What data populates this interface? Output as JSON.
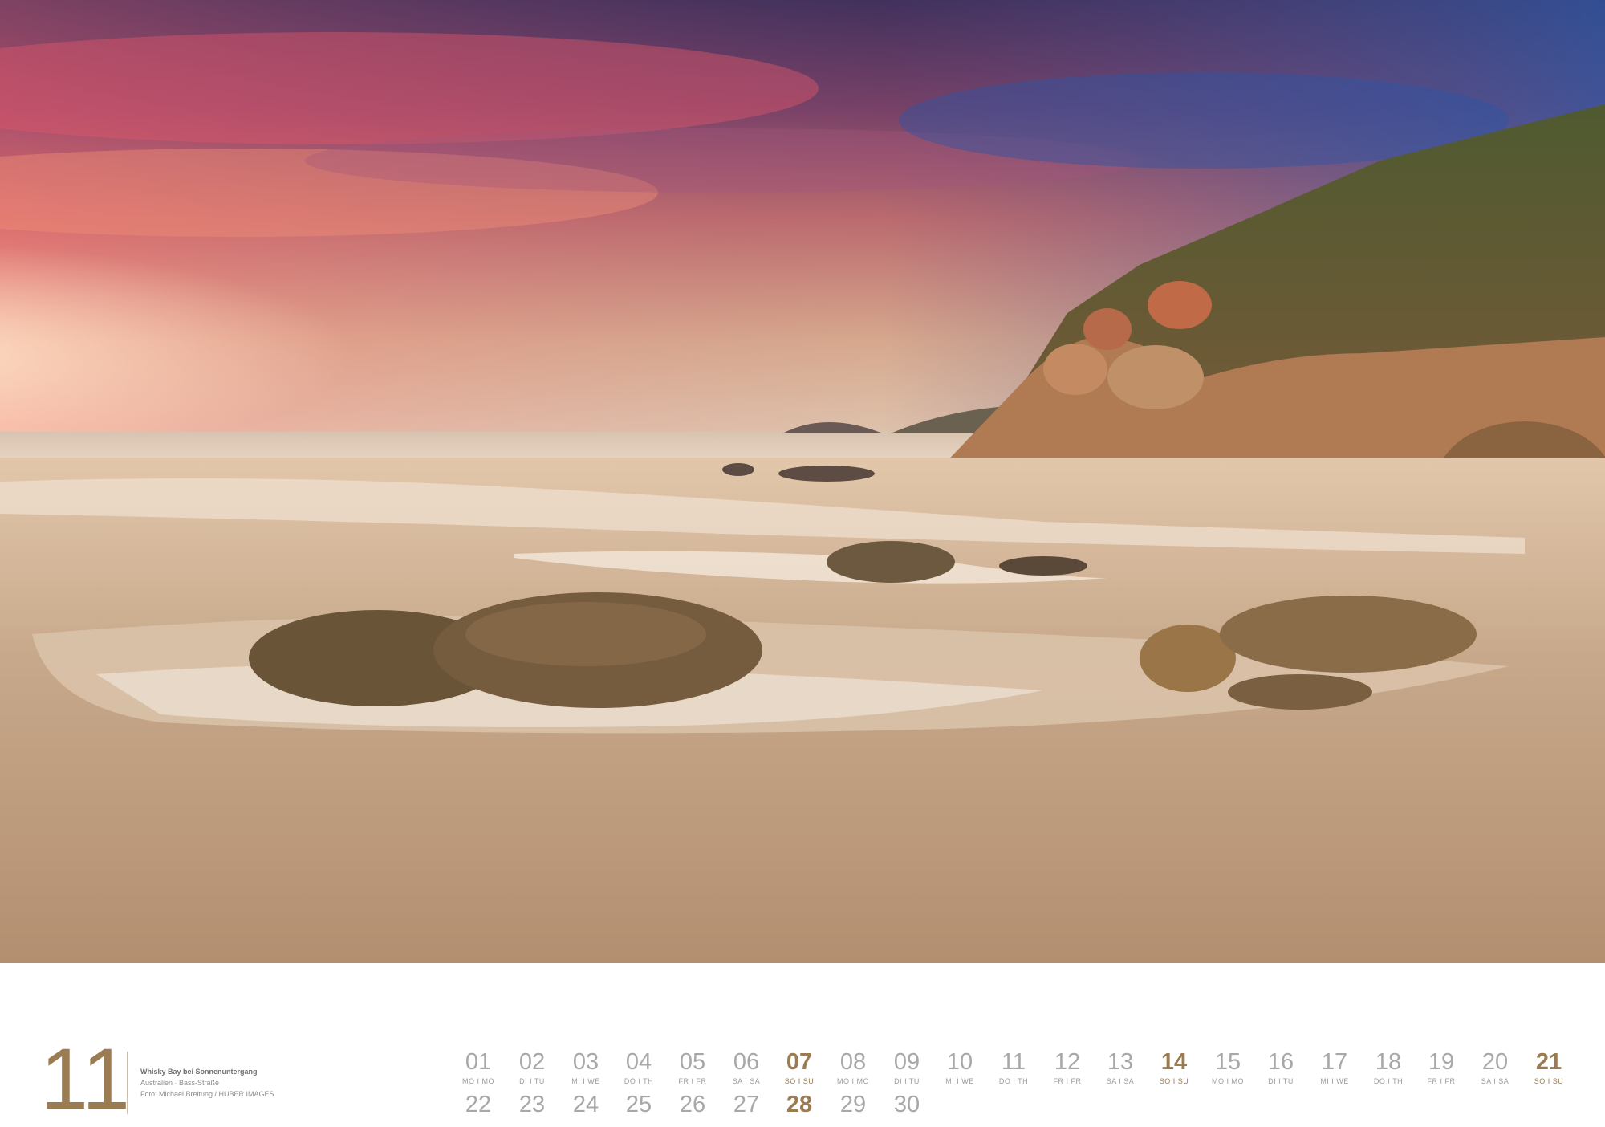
{
  "month": {
    "number": "11"
  },
  "caption": {
    "title": "Whisky Bay bei Sonnenuntergang",
    "location": "Australien · Bass-Straße",
    "credit": "Foto: Michael Breitung / HUBER IMAGES"
  },
  "colors": {
    "accent": "#9a7b52",
    "day_gray": "#a8a8a8"
  },
  "days_row1": [
    {
      "num": "01",
      "wd": "MO I MO",
      "sunday": false
    },
    {
      "num": "02",
      "wd": "DI I TU",
      "sunday": false
    },
    {
      "num": "03",
      "wd": "MI I WE",
      "sunday": false
    },
    {
      "num": "04",
      "wd": "DO I TH",
      "sunday": false
    },
    {
      "num": "05",
      "wd": "FR I FR",
      "sunday": false
    },
    {
      "num": "06",
      "wd": "SA I SA",
      "sunday": false
    },
    {
      "num": "07",
      "wd": "SO I SU",
      "sunday": true
    },
    {
      "num": "08",
      "wd": "MO I MO",
      "sunday": false
    },
    {
      "num": "09",
      "wd": "DI I TU",
      "sunday": false
    },
    {
      "num": "10",
      "wd": "MI I WE",
      "sunday": false
    },
    {
      "num": "11",
      "wd": "DO I TH",
      "sunday": false
    },
    {
      "num": "12",
      "wd": "FR I FR",
      "sunday": false
    },
    {
      "num": "13",
      "wd": "SA I SA",
      "sunday": false
    },
    {
      "num": "14",
      "wd": "SO I SU",
      "sunday": true
    },
    {
      "num": "15",
      "wd": "MO I MO",
      "sunday": false
    },
    {
      "num": "16",
      "wd": "DI I TU",
      "sunday": false
    },
    {
      "num": "17",
      "wd": "MI I WE",
      "sunday": false
    },
    {
      "num": "18",
      "wd": "DO I TH",
      "sunday": false
    },
    {
      "num": "19",
      "wd": "FR I FR",
      "sunday": false
    },
    {
      "num": "20",
      "wd": "SA I SA",
      "sunday": false
    },
    {
      "num": "21",
      "wd": "SO I SU",
      "sunday": true
    }
  ],
  "days_row2": [
    {
      "num": "22",
      "sunday": false
    },
    {
      "num": "23",
      "sunday": false
    },
    {
      "num": "24",
      "sunday": false
    },
    {
      "num": "25",
      "sunday": false
    },
    {
      "num": "26",
      "sunday": false
    },
    {
      "num": "27",
      "sunday": false
    },
    {
      "num": "28",
      "sunday": true
    },
    {
      "num": "29",
      "sunday": false
    },
    {
      "num": "30",
      "sunday": false
    }
  ]
}
